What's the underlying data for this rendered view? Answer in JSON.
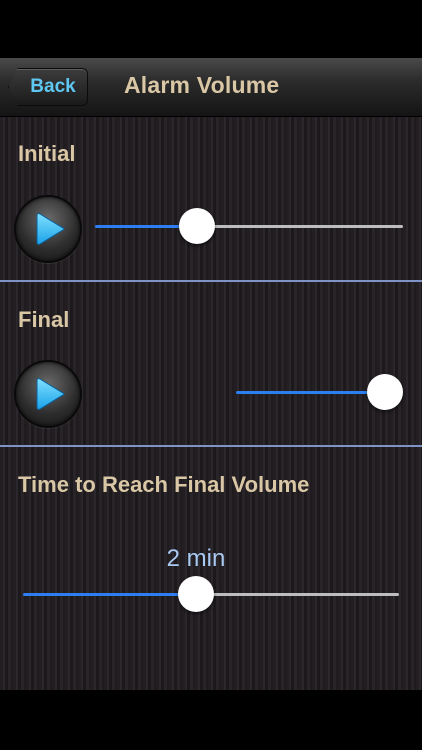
{
  "header": {
    "back_label": "Back",
    "title": "Alarm Volume"
  },
  "initial": {
    "label": "Initial",
    "volume": 0.33
  },
  "final": {
    "label": "Final",
    "volume": 1.0
  },
  "ramp": {
    "label": "Time to Reach Final Volume",
    "value_text": "2 min",
    "position": 0.46
  },
  "colors": {
    "accent": "#2d7ef0",
    "label": "#d9c7a5",
    "back_text": "#5ec8f2",
    "divider": "#7f93c6",
    "value_text": "#a9c9f2"
  },
  "icons": {
    "play": "play-icon"
  }
}
